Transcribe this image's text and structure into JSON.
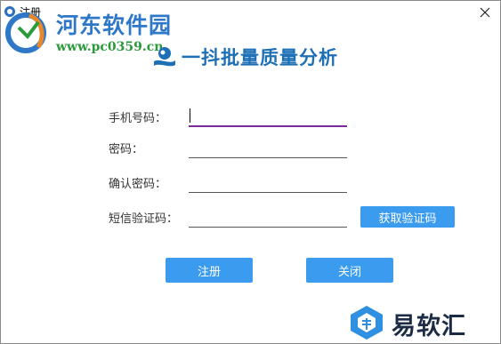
{
  "window": {
    "title": "注册"
  },
  "watermark": {
    "site_name": "河东软件园",
    "url": "www.pc0359.cn"
  },
  "brand": {
    "title": "一抖批量质量分析"
  },
  "form": {
    "phone_label": "手机号码：",
    "password_label": "密码：",
    "confirm_label": "确认密码：",
    "sms_label": "短信验证码："
  },
  "buttons": {
    "get_code": "获取验证码",
    "register": "注册",
    "close": "关闭"
  },
  "corner_watermark": {
    "text": "易软汇"
  },
  "colors": {
    "accent_button": "#3a9bef",
    "focus_underline": "#7a2a9a",
    "brand_text": "#1d6fb6"
  }
}
